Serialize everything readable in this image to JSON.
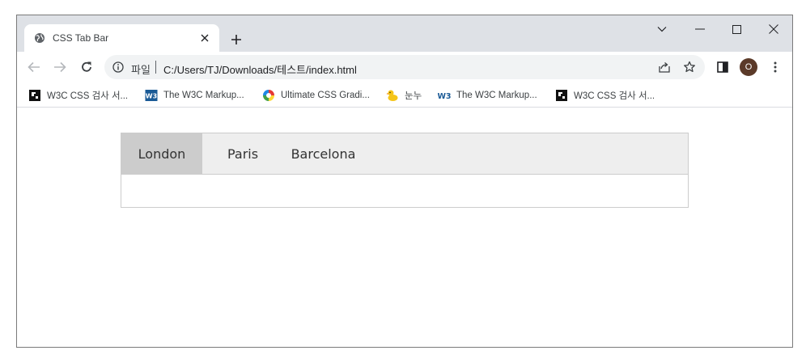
{
  "browser": {
    "tab": {
      "title": "CSS Tab Bar",
      "icon": "globe-icon"
    },
    "window_controls": [
      "chevron-down-icon",
      "minimize-icon",
      "maximize-icon",
      "close-icon"
    ],
    "address": {
      "scheme_label": "파일",
      "url": "C:/Users/TJ/Downloads/테스트/index.html"
    },
    "profile_initial": "O"
  },
  "bookmarks": [
    {
      "label": "W3C CSS 검사 서...",
      "icon": "puzzle-icon"
    },
    {
      "label": "The W3C Markup...",
      "icon": "w3c-icon"
    },
    {
      "label": "Ultimate CSS Gradi...",
      "icon": "color-wheel-icon"
    },
    {
      "label": "눈누",
      "icon": "duck-icon"
    },
    {
      "label": "The W3C Markup...",
      "icon": "w3-icon"
    },
    {
      "label": "W3C CSS 검사 서...",
      "icon": "puzzle-icon"
    }
  ],
  "page": {
    "tabs": [
      {
        "label": "London",
        "active": true
      },
      {
        "label": "Paris",
        "active": false
      },
      {
        "label": "Barcelona",
        "active": false
      }
    ]
  },
  "colors": {
    "chrome_frame": "#dee1e6",
    "omnibox": "#f1f3f4",
    "tab_bar_bg": "#eeeeee",
    "active_tab_bg": "#cccccc",
    "profile_avatar": "#5b3a29"
  }
}
